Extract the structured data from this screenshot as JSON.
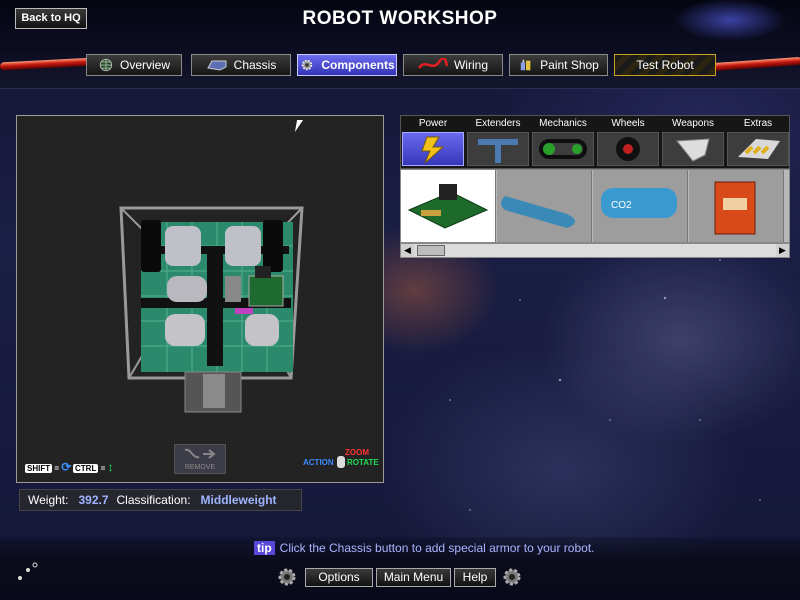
{
  "header": {
    "back_label": "Back to HQ",
    "title": "ROBOT WORKSHOP"
  },
  "nav_tabs": [
    {
      "label": "Overview",
      "icon": "globe-icon"
    },
    {
      "label": "Chassis",
      "icon": "chassis-icon"
    },
    {
      "label": "Components",
      "icon": "gear-icon",
      "active": true
    },
    {
      "label": "Wiring",
      "icon": "wire-icon"
    },
    {
      "label": "Paint Shop",
      "icon": "paint-cans-icon"
    },
    {
      "label": "Test Robot",
      "icon": ""
    }
  ],
  "viewport": {
    "shift_key": "SHIFT",
    "ctrl_key": "CTRL",
    "action_label": "ACTION",
    "zoom_label": "ZOOM",
    "rotate_label": "ROTATE",
    "remove_label": "REMOVE"
  },
  "status": {
    "weight_label": "Weight:",
    "weight_value": "392.7",
    "class_label": "Classification:",
    "class_value": "Middleweight"
  },
  "categories": [
    {
      "label": "Power",
      "icon": "lightning-icon",
      "active": true
    },
    {
      "label": "Extenders",
      "icon": "t-extender-icon"
    },
    {
      "label": "Mechanics",
      "icon": "chain-drive-icon"
    },
    {
      "label": "Wheels",
      "icon": "wheel-icon"
    },
    {
      "label": "Weapons",
      "icon": "blade-icon"
    },
    {
      "label": "Extras",
      "icon": "hazard-plate-icon"
    }
  ],
  "parts": [
    {
      "name": "circuit-board-part",
      "selected": true
    },
    {
      "name": "blue-tank-part"
    },
    {
      "name": "co2-tank-part",
      "label": "CO2"
    },
    {
      "name": "battery-part"
    }
  ],
  "tip": {
    "badge": "tip",
    "text": "Click the Chassis button to add special armor to your robot."
  },
  "bottom_buttons": {
    "options": "Options",
    "main_menu": "Main Menu",
    "help": "Help"
  },
  "colors": {
    "accent": "#4a4ae0",
    "value_text": "#9fb4ff",
    "hint_blue": "#3a8cff",
    "hint_green": "#22dd55",
    "hint_red": "#ff3333"
  }
}
